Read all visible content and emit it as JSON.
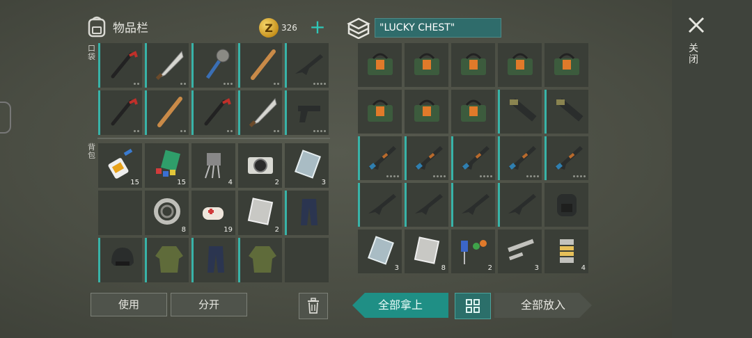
{
  "inventory": {
    "title": "物品栏",
    "currency_count": "326",
    "currency_symbol": "Z",
    "pocket_label": "口袋",
    "backpack_label": "背包",
    "pockets": [
      {
        "icon": "crowbar-icon",
        "dur": 2,
        "accent": true
      },
      {
        "icon": "machete-icon",
        "dur": 2,
        "accent": true
      },
      {
        "icon": "spiked-club-icon",
        "dur": 3,
        "accent": true
      },
      {
        "icon": "baseball-bat-icon",
        "dur": 2,
        "accent": true
      },
      {
        "icon": "assault-rifle-icon",
        "dur": 4,
        "accent": true
      },
      {
        "icon": "crowbar-icon",
        "dur": 2,
        "accent": true
      },
      {
        "icon": "baseball-bat-icon",
        "dur": 2,
        "accent": true
      },
      {
        "icon": "crowbar-icon",
        "dur": 2,
        "accent": true
      },
      {
        "icon": "machete-icon",
        "dur": 2,
        "accent": true
      },
      {
        "icon": "pistol-icon",
        "dur": 4,
        "accent": true
      }
    ],
    "backpack": [
      {
        "icon": "glue-icon",
        "qty": "15"
      },
      {
        "icon": "cloth-icon",
        "qty": "15"
      },
      {
        "icon": "transistor-icon",
        "qty": "4"
      },
      {
        "icon": "camera-icon",
        "qty": "2"
      },
      {
        "icon": "glass-icon",
        "qty": "3"
      },
      {
        "icon": "",
        "qty": ""
      },
      {
        "icon": "bearing-icon",
        "qty": "8"
      },
      {
        "icon": "bandage-icon",
        "qty": "19"
      },
      {
        "icon": "metal-plate-icon",
        "qty": "2"
      },
      {
        "icon": "pants-icon",
        "qty": "",
        "accent": true
      },
      {
        "icon": "helmet-icon",
        "qty": "",
        "accent": true
      },
      {
        "icon": "jacket-icon",
        "qty": "",
        "accent": true
      },
      {
        "icon": "pants-icon",
        "qty": "",
        "accent": true
      },
      {
        "icon": "jacket-icon",
        "qty": "",
        "accent": true
      },
      {
        "icon": "",
        "qty": ""
      }
    ],
    "use_label": "使用",
    "split_label": "分开"
  },
  "chest": {
    "title": "\"LUCKY CHEST\"",
    "items": [
      {
        "icon": "explosive-icon"
      },
      {
        "icon": "explosive-icon"
      },
      {
        "icon": "explosive-icon"
      },
      {
        "icon": "explosive-icon"
      },
      {
        "icon": "explosive-icon"
      },
      {
        "icon": "explosive-icon"
      },
      {
        "icon": "explosive-icon"
      },
      {
        "icon": "explosive-icon"
      },
      {
        "icon": "launcher-icon",
        "accent": true
      },
      {
        "icon": "launcher-icon",
        "accent": true
      },
      {
        "icon": "ak-rifle-icon",
        "accent": true,
        "dur": 4
      },
      {
        "icon": "ak-rifle-icon",
        "accent": true,
        "dur": 4
      },
      {
        "icon": "ak-rifle-icon",
        "accent": true,
        "dur": 4
      },
      {
        "icon": "ak-rifle-icon",
        "accent": true,
        "dur": 4
      },
      {
        "icon": "ak-rifle-icon",
        "accent": true,
        "dur": 4
      },
      {
        "icon": "assault-rifle-icon",
        "accent": true
      },
      {
        "icon": "assault-rifle-icon",
        "accent": true
      },
      {
        "icon": "assault-rifle-icon",
        "accent": true
      },
      {
        "icon": "assault-rifle-icon",
        "accent": true
      },
      {
        "icon": "backpack-icon"
      },
      {
        "icon": "glass-icon",
        "qty": "3"
      },
      {
        "icon": "metal-plate-icon",
        "qty": "8"
      },
      {
        "icon": "capacitor-icon",
        "qty": "2"
      },
      {
        "icon": "pipe-icon",
        "qty": "3"
      },
      {
        "icon": "spring-icon",
        "qty": "4"
      }
    ],
    "take_all_label": "全部拿上",
    "put_all_label": "全部放入"
  },
  "close_label": "关闭",
  "colors": {
    "accent": "#38b3a8",
    "chest_name_bg": "#2f6c6b",
    "take_all_bg": "#1f8f85"
  }
}
